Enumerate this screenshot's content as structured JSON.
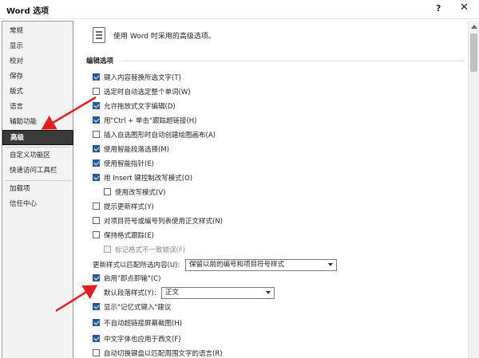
{
  "window": {
    "title": "Word 选项",
    "help": "?",
    "close": "✕"
  },
  "sidebar": {
    "items": [
      {
        "label": "常规"
      },
      {
        "label": "显示"
      },
      {
        "label": "校对"
      },
      {
        "label": "保存"
      },
      {
        "label": "版式"
      },
      {
        "label": "语言"
      },
      {
        "label": "辅助功能"
      },
      {
        "label": "高级",
        "active": true
      },
      {
        "label": "自定义功能区"
      },
      {
        "label": "快速访问工具栏"
      },
      {
        "label": "加载项"
      },
      {
        "label": "信任中心"
      }
    ]
  },
  "header": {
    "text": "使用 Word 时采用的高级选项。"
  },
  "section": {
    "title": "编辑选项"
  },
  "options": [
    {
      "label": "键入内容替换所选文字(T)",
      "checked": true
    },
    {
      "label": "选定时自动选定整个单词(W)",
      "checked": false
    },
    {
      "label": "允许拖放式文字编辑(D)",
      "checked": true
    },
    {
      "label": "用\"Ctrl + 单击\"跟踪超链接(H)",
      "checked": true
    },
    {
      "label": "插入自选图形时自动创建绘图画布(A)",
      "checked": false
    },
    {
      "label": "使用智能段落选择(M)",
      "checked": true
    },
    {
      "label": "使用智能指针(E)",
      "checked": true
    },
    {
      "label": "用 Insert 键控制改写模式(O)",
      "checked": true
    },
    {
      "label": "使用改写模式(V)",
      "checked": false
    },
    {
      "label": "提示更新样式(Y)",
      "checked": false
    },
    {
      "label": "对项目符号或编号列表使用正文样式(N)",
      "checked": false
    },
    {
      "label": "保持格式跟踪(E)",
      "checked": false
    },
    {
      "label": "标记格式不一致错误(F)",
      "checked": false,
      "disabled": true
    }
  ],
  "update_style": {
    "label": "更新样式以匹配所选内容(U):",
    "value": "保留以前的编号和项目符号样式"
  },
  "click_type": {
    "label": "启用\"即点即输\"(C)",
    "checked": true
  },
  "default_para": {
    "label": "默认段落样式(Y):",
    "value": "正文"
  },
  "options2": [
    {
      "label": "显示\"记忆式键入\"建议",
      "checked": true
    },
    {
      "label": "不自动超链接屏幕截图(H)",
      "checked": true
    },
    {
      "label": "中文字体也应用于西文(F)",
      "checked": true
    },
    {
      "label": "自动切换键盘以匹配周围文字的语言(R)",
      "checked": false
    }
  ],
  "colors": {
    "accent": "#2b579a",
    "annotation": "#e02020"
  }
}
